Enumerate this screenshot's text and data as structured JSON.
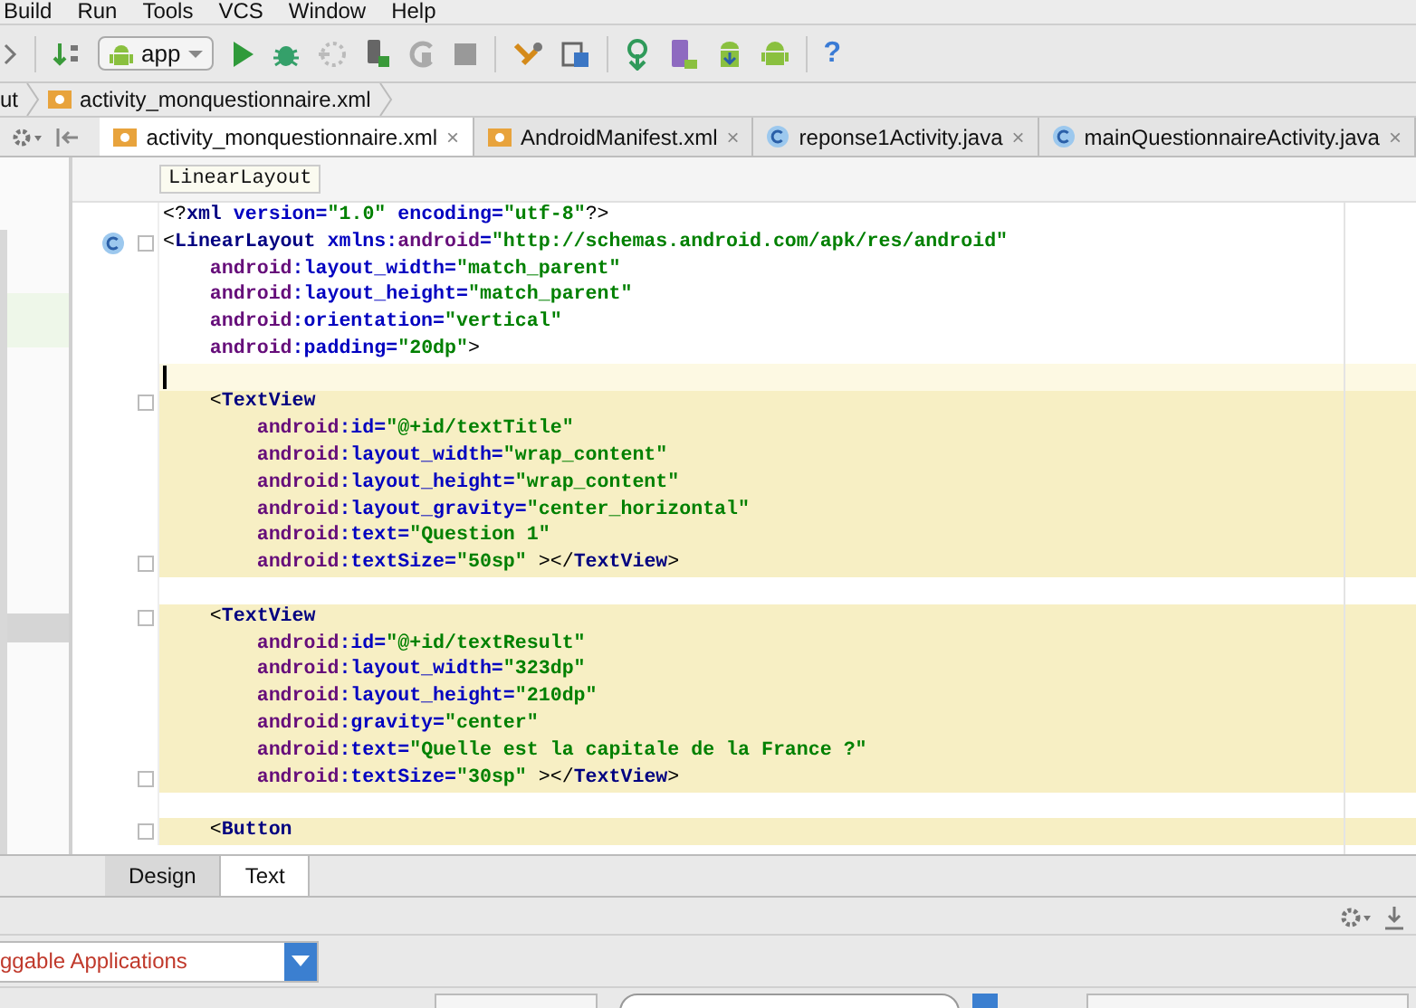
{
  "menu": [
    "Build",
    "Run",
    "Tools",
    "VCS",
    "Window",
    "Help"
  ],
  "toolbar": {
    "config": "app",
    "help": "?"
  },
  "breadcrumbs": [
    "ut",
    "activity_monquestionnaire.xml"
  ],
  "tabs": [
    {
      "label": "activity_monquestionnaire.xml",
      "kind": "xml",
      "close": "×",
      "selected": true
    },
    {
      "label": "AndroidManifest.xml",
      "kind": "xml",
      "close": "×",
      "selected": false
    },
    {
      "label": "reponse1Activity.java",
      "kind": "class",
      "close": "×",
      "selected": false
    },
    {
      "label": "mainQuestionnaireActivity.java",
      "kind": "class",
      "close": "×",
      "selected": false
    }
  ],
  "tag_hint": "LinearLayout",
  "code": [
    {
      "tokens": [
        {
          "kind": "punct",
          "text": "<?"
        },
        {
          "kind": "tag",
          "text": "xml"
        },
        {
          "kind": "attr",
          "text": " version="
        },
        {
          "kind": "value",
          "text": "\"1.0\""
        },
        {
          "kind": "attr",
          "text": " encoding="
        },
        {
          "kind": "value",
          "text": "\"utf-8\""
        },
        {
          "kind": "punct",
          "text": "?>"
        }
      ],
      "kind": "plain",
      "fold": false,
      "class_marker": false
    },
    {
      "tokens": [
        {
          "kind": "punct",
          "text": "<"
        },
        {
          "kind": "tag",
          "text": "LinearLayout"
        },
        {
          "kind": "attr",
          "text": " xmlns:"
        },
        {
          "kind": "ns",
          "text": "android"
        },
        {
          "kind": "attr",
          "text": "="
        },
        {
          "kind": "value",
          "text": "\"http://schemas.android.com/apk/res/android\""
        }
      ],
      "kind": "plain",
      "fold": true,
      "class_marker": true
    },
    {
      "tokens": [
        {
          "kind": "ns",
          "text": "    android"
        },
        {
          "kind": "attr",
          "text": ":layout_width="
        },
        {
          "kind": "value",
          "text": "\"match_parent\""
        }
      ],
      "kind": "plain",
      "fold": false,
      "class_marker": false
    },
    {
      "tokens": [
        {
          "kind": "ns",
          "text": "    android"
        },
        {
          "kind": "attr",
          "text": ":layout_height="
        },
        {
          "kind": "value",
          "text": "\"match_parent\""
        }
      ],
      "kind": "plain",
      "fold": false,
      "class_marker": false
    },
    {
      "tokens": [
        {
          "kind": "ns",
          "text": "    android"
        },
        {
          "kind": "attr",
          "text": ":orientation="
        },
        {
          "kind": "value",
          "text": "\"vertical\""
        }
      ],
      "kind": "plain",
      "fold": false,
      "class_marker": false
    },
    {
      "tokens": [
        {
          "kind": "ns",
          "text": "    android"
        },
        {
          "kind": "attr",
          "text": ":padding="
        },
        {
          "kind": "value",
          "text": "\"20dp\""
        },
        {
          "kind": "punct",
          "text": ">"
        }
      ],
      "kind": "plain",
      "fold": false,
      "class_marker": false
    },
    {
      "kind": "caret",
      "fold": false,
      "class_marker": false
    },
    {
      "tokens": [
        {
          "kind": "punct",
          "text": "    <"
        },
        {
          "kind": "tag",
          "text": "TextView"
        }
      ],
      "kind": "block",
      "fold": true,
      "class_marker": false
    },
    {
      "tokens": [
        {
          "kind": "ns",
          "text": "        android"
        },
        {
          "kind": "attr",
          "text": ":id="
        },
        {
          "kind": "value",
          "text": "\"@+id/textTitle\""
        }
      ],
      "kind": "block",
      "fold": false,
      "class_marker": false
    },
    {
      "tokens": [
        {
          "kind": "ns",
          "text": "        android"
        },
        {
          "kind": "attr",
          "text": ":layout_width="
        },
        {
          "kind": "value",
          "text": "\"wrap_content\""
        }
      ],
      "kind": "block",
      "fold": false,
      "class_marker": false
    },
    {
      "tokens": [
        {
          "kind": "ns",
          "text": "        android"
        },
        {
          "kind": "attr",
          "text": ":layout_height="
        },
        {
          "kind": "value",
          "text": "\"wrap_content\""
        }
      ],
      "kind": "block",
      "fold": false,
      "class_marker": false
    },
    {
      "tokens": [
        {
          "kind": "ns",
          "text": "        android"
        },
        {
          "kind": "attr",
          "text": ":layout_gravity="
        },
        {
          "kind": "value",
          "text": "\"center_horizontal\""
        }
      ],
      "kind": "block",
      "fold": false,
      "class_marker": false
    },
    {
      "tokens": [
        {
          "kind": "ns",
          "text": "        android"
        },
        {
          "kind": "attr",
          "text": ":text="
        },
        {
          "kind": "value",
          "text": "\"Question 1\""
        }
      ],
      "kind": "block",
      "fold": false,
      "class_marker": false
    },
    {
      "tokens": [
        {
          "kind": "ns",
          "text": "        android"
        },
        {
          "kind": "attr",
          "text": ":textSize="
        },
        {
          "kind": "value",
          "text": "\"50sp\""
        },
        {
          "kind": "punct",
          "text": " ></"
        },
        {
          "kind": "tag",
          "text": "TextView"
        },
        {
          "kind": "punct",
          "text": ">"
        }
      ],
      "kind": "block",
      "fold": true,
      "class_marker": false
    },
    {
      "kind": "plain",
      "fold": false,
      "class_marker": false
    },
    {
      "tokens": [
        {
          "kind": "punct",
          "text": "    <"
        },
        {
          "kind": "tag",
          "text": "TextView"
        }
      ],
      "kind": "block",
      "fold": true,
      "class_marker": false
    },
    {
      "tokens": [
        {
          "kind": "ns",
          "text": "        android"
        },
        {
          "kind": "attr",
          "text": ":id="
        },
        {
          "kind": "value",
          "text": "\"@+id/textResult\""
        }
      ],
      "kind": "block",
      "fold": false,
      "class_marker": false
    },
    {
      "tokens": [
        {
          "kind": "ns",
          "text": "        android"
        },
        {
          "kind": "attr",
          "text": ":layout_width="
        },
        {
          "kind": "value",
          "text": "\"323dp\""
        }
      ],
      "kind": "block",
      "fold": false,
      "class_marker": false
    },
    {
      "tokens": [
        {
          "kind": "ns",
          "text": "        android"
        },
        {
          "kind": "attr",
          "text": ":layout_height="
        },
        {
          "kind": "value",
          "text": "\"210dp\""
        }
      ],
      "kind": "block",
      "fold": false,
      "class_marker": false
    },
    {
      "tokens": [
        {
          "kind": "ns",
          "text": "        android"
        },
        {
          "kind": "attr",
          "text": ":gravity="
        },
        {
          "kind": "value",
          "text": "\"center\""
        }
      ],
      "kind": "block",
      "fold": false,
      "class_marker": false
    },
    {
      "tokens": [
        {
          "kind": "ns",
          "text": "        android"
        },
        {
          "kind": "attr",
          "text": ":text="
        },
        {
          "kind": "value",
          "text": "\"Quelle est la capitale de la France ?\""
        }
      ],
      "kind": "block",
      "fold": false,
      "class_marker": false
    },
    {
      "tokens": [
        {
          "kind": "ns",
          "text": "        android"
        },
        {
          "kind": "attr",
          "text": ":textSize="
        },
        {
          "kind": "value",
          "text": "\"30sp\""
        },
        {
          "kind": "punct",
          "text": " ></"
        },
        {
          "kind": "tag",
          "text": "TextView"
        },
        {
          "kind": "punct",
          "text": ">"
        }
      ],
      "kind": "block",
      "fold": true,
      "class_marker": false
    },
    {
      "kind": "plain",
      "fold": false,
      "class_marker": false
    },
    {
      "tokens": [
        {
          "kind": "punct",
          "text": "    <"
        },
        {
          "kind": "tag",
          "text": "Button"
        }
      ],
      "kind": "block",
      "fold": true,
      "class_marker": false
    }
  ],
  "view_tabs": [
    {
      "label": "Design",
      "selected": false
    },
    {
      "label": "Text",
      "selected": true
    }
  ],
  "panel": {
    "filter": "ggable Applications",
    "checkbox_checked": true
  }
}
